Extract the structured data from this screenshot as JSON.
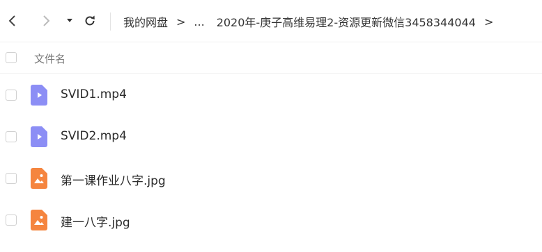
{
  "toolbar": {
    "icons": {
      "back": "chevron-left-icon",
      "forward": "chevron-right-icon",
      "dropdown": "caret-down-icon",
      "refresh": "refresh-icon"
    },
    "breadcrumb": {
      "root": "我的网盘",
      "separator": ">",
      "ellipsis": "...",
      "current": "2020年-庚子高维易理2-资源更新微信3458344044",
      "trailing_separator": ">"
    }
  },
  "list": {
    "column_header": "文件名",
    "files": [
      {
        "name": "SVID1.mp4",
        "type": "video",
        "icon": "video-file-icon"
      },
      {
        "name": "SVID2.mp4",
        "type": "video",
        "icon": "video-file-icon"
      },
      {
        "name": "第一课作业八字.jpg",
        "type": "image",
        "icon": "image-file-icon"
      },
      {
        "name": "建一八字.jpg",
        "type": "image",
        "icon": "image-file-icon"
      }
    ]
  },
  "colors": {
    "video_icon": "#8c8ef5",
    "image_icon": "#f5853f",
    "checkbox_border": "#d0d0d0",
    "divider": "#f1f1f1"
  }
}
